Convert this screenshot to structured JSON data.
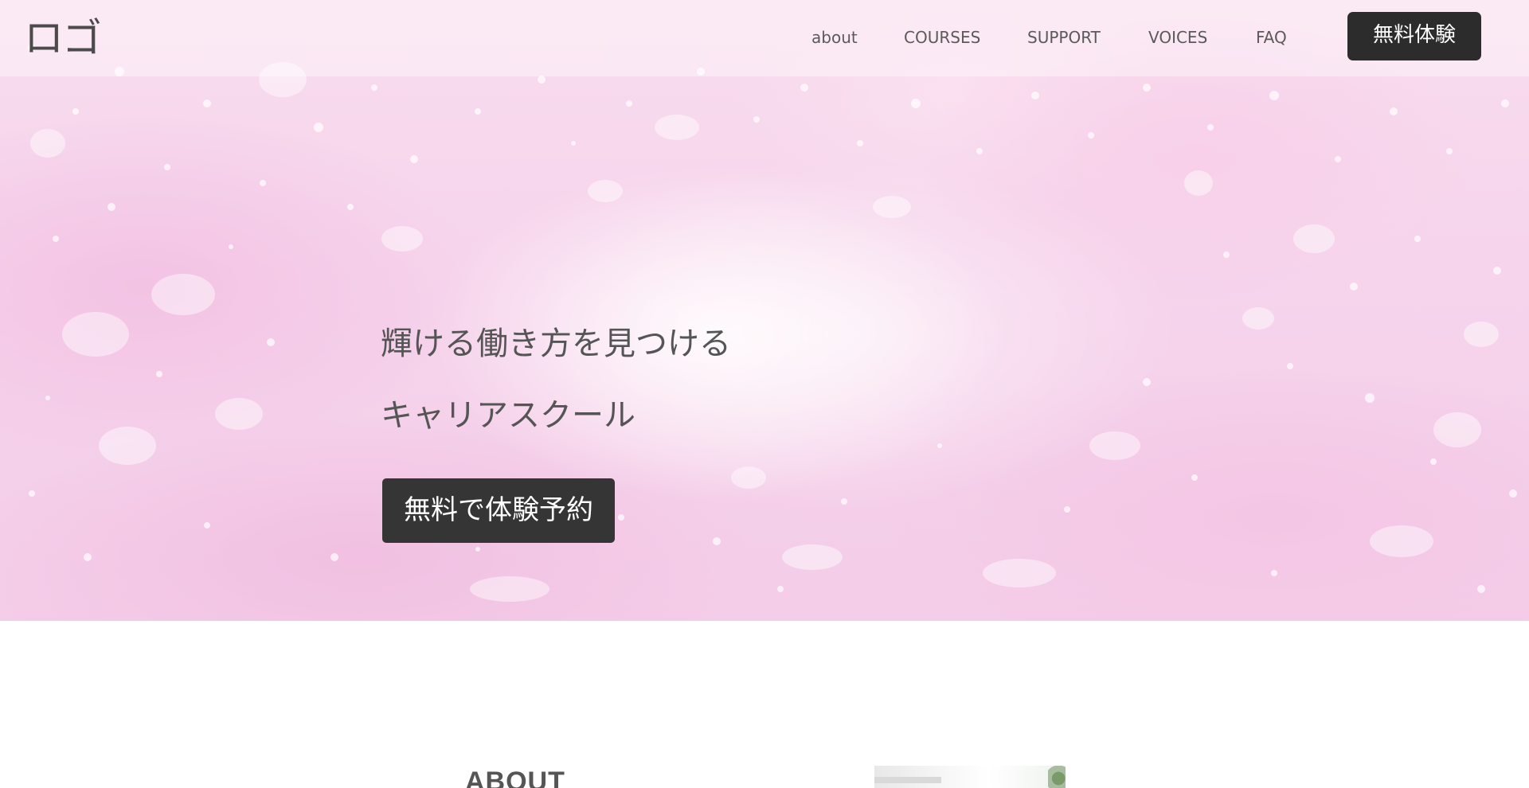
{
  "header": {
    "logo": "ロゴ",
    "nav": [
      {
        "label": "about"
      },
      {
        "label": "COURSES"
      },
      {
        "label": "SUPPORT"
      },
      {
        "label": "VOICES"
      },
      {
        "label": "FAQ"
      }
    ],
    "cta_label": "無料体験"
  },
  "hero": {
    "line1": "輝ける働き方を見つける",
    "line2": "キャリアスクール",
    "cta_label": "無料で体験予約"
  },
  "about": {
    "title": "ABOUT"
  },
  "colors": {
    "hero_pink": "#f6d4ec",
    "button_dark": "#2c2c2c",
    "text_gray": "#555555"
  }
}
